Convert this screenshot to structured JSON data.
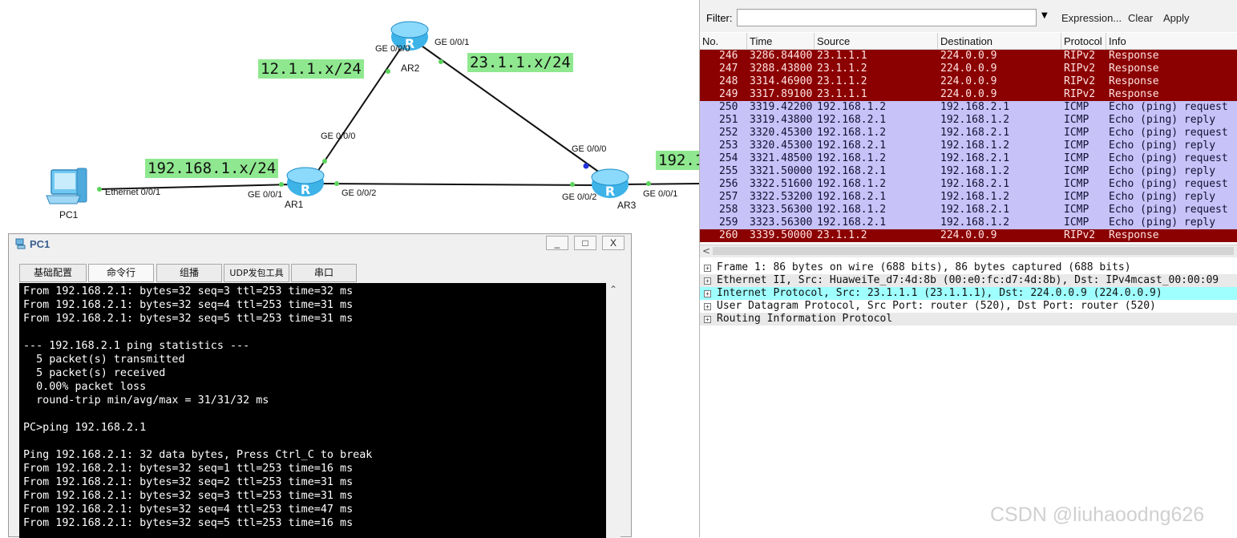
{
  "topology": {
    "networks": {
      "ar1_ar2": "12.1.1.x/24",
      "ar2_ar3": "23.1.1.x/24",
      "pc_lan": "192.168.1.x/24",
      "ar3_lan": "192.1"
    },
    "devices": {
      "pc1": "PC1",
      "ar1": "AR1",
      "ar2": "AR2",
      "ar3": "AR3"
    },
    "router_glyph": "R",
    "ports": {
      "pc1_eth": "Ethernet 0/0/1",
      "ar1_g001": "GE 0/0/1",
      "ar1_g000": "GE 0/0/0",
      "ar1_g002": "GE 0/0/2",
      "ar2_g000": "GE 0/0/0",
      "ar2_g001": "GE 0/0/1",
      "ar3_g000": "GE 0/0/0",
      "ar3_g002": "GE 0/0/2",
      "ar3_g001": "GE 0/0/1"
    }
  },
  "pc_window": {
    "title": "PC1",
    "buttons": {
      "minimize": "_",
      "maximize": "□",
      "close": "X"
    },
    "tabs": [
      "基础配置",
      "命令行",
      "组播",
      "UDP发包工具",
      "串口"
    ],
    "active_tab": "命令行",
    "console_lines": [
      "From 192.168.2.1: bytes=32 seq=3 ttl=253 time=32 ms",
      "From 192.168.2.1: bytes=32 seq=4 ttl=253 time=31 ms",
      "From 192.168.2.1: bytes=32 seq=5 ttl=253 time=31 ms",
      "",
      "--- 192.168.2.1 ping statistics ---",
      "  5 packet(s) transmitted",
      "  5 packet(s) received",
      "  0.00% packet loss",
      "  round-trip min/avg/max = 31/31/32 ms",
      "",
      "PC>ping 192.168.2.1",
      "",
      "Ping 192.168.2.1: 32 data bytes, Press Ctrl_C to break",
      "From 192.168.2.1: bytes=32 seq=1 ttl=253 time=16 ms",
      "From 192.168.2.1: bytes=32 seq=2 ttl=253 time=31 ms",
      "From 192.168.2.1: bytes=32 seq=3 ttl=253 time=31 ms",
      "From 192.168.2.1: bytes=32 seq=4 ttl=253 time=47 ms",
      "From 192.168.2.1: bytes=32 seq=5 ttl=253 time=16 ms"
    ],
    "scroll_up_glyph": "⌃"
  },
  "wireshark": {
    "filter": {
      "label": "Filter:",
      "value": "",
      "dropdown": "▼",
      "expression": "Expression...",
      "clear": "Clear",
      "apply": "Apply"
    },
    "columns": [
      "No.",
      "Time",
      "Source",
      "Destination",
      "Protocol",
      "Info"
    ],
    "packets": [
      {
        "no": "246",
        "time": "3286.84400",
        "src": "23.1.1.1",
        "dst": "224.0.0.9",
        "proto": "RIPv2",
        "info": "Response"
      },
      {
        "no": "247",
        "time": "3288.43800",
        "src": "23.1.1.2",
        "dst": "224.0.0.9",
        "proto": "RIPv2",
        "info": "Response"
      },
      {
        "no": "248",
        "time": "3314.46900",
        "src": "23.1.1.2",
        "dst": "224.0.0.9",
        "proto": "RIPv2",
        "info": "Response"
      },
      {
        "no": "249",
        "time": "3317.89100",
        "src": "23.1.1.1",
        "dst": "224.0.0.9",
        "proto": "RIPv2",
        "info": "Response"
      },
      {
        "no": "250",
        "time": "3319.42200",
        "src": "192.168.1.2",
        "dst": "192.168.2.1",
        "proto": "ICMP",
        "info": "Echo (ping) request"
      },
      {
        "no": "251",
        "time": "3319.43800",
        "src": "192.168.2.1",
        "dst": "192.168.1.2",
        "proto": "ICMP",
        "info": "Echo (ping) reply"
      },
      {
        "no": "252",
        "time": "3320.45300",
        "src": "192.168.1.2",
        "dst": "192.168.2.1",
        "proto": "ICMP",
        "info": "Echo (ping) request"
      },
      {
        "no": "253",
        "time": "3320.45300",
        "src": "192.168.2.1",
        "dst": "192.168.1.2",
        "proto": "ICMP",
        "info": "Echo (ping) reply"
      },
      {
        "no": "254",
        "time": "3321.48500",
        "src": "192.168.1.2",
        "dst": "192.168.2.1",
        "proto": "ICMP",
        "info": "Echo (ping) request"
      },
      {
        "no": "255",
        "time": "3321.50000",
        "src": "192.168.2.1",
        "dst": "192.168.1.2",
        "proto": "ICMP",
        "info": "Echo (ping) reply"
      },
      {
        "no": "256",
        "time": "3322.51600",
        "src": "192.168.1.2",
        "dst": "192.168.2.1",
        "proto": "ICMP",
        "info": "Echo (ping) request"
      },
      {
        "no": "257",
        "time": "3322.53200",
        "src": "192.168.2.1",
        "dst": "192.168.1.2",
        "proto": "ICMP",
        "info": "Echo (ping) reply"
      },
      {
        "no": "258",
        "time": "3323.56300",
        "src": "192.168.1.2",
        "dst": "192.168.2.1",
        "proto": "ICMP",
        "info": "Echo (ping) request"
      },
      {
        "no": "259",
        "time": "3323.56300",
        "src": "192.168.2.1",
        "dst": "192.168.1.2",
        "proto": "ICMP",
        "info": "Echo (ping) reply"
      },
      {
        "no": "260",
        "time": "3339.50000",
        "src": "23.1.1.2",
        "dst": "224.0.0.9",
        "proto": "RIPv2",
        "info": "Response"
      }
    ],
    "details": [
      {
        "text": "Frame 1: 86 bytes on wire (688 bits), 86 bytes captured (688 bits)",
        "style": "plain"
      },
      {
        "text": "Ethernet II, Src: HuaweiTe_d7:4d:8b (00:e0:fc:d7:4d:8b), Dst: IPv4mcast_00:00:09",
        "style": "grey"
      },
      {
        "text": "Internet Protocol, Src: 23.1.1.1 (23.1.1.1), Dst: 224.0.0.9 (224.0.0.9)",
        "style": "selected"
      },
      {
        "text": "User Datagram Protocol, Src Port: router (520), Dst Port: router (520)",
        "style": "plain"
      },
      {
        "text": "Routing Information Protocol",
        "style": "grey"
      }
    ],
    "expander_glyph": "+",
    "scroll_left_glyph": "<",
    "colors": {
      "rip_row": "#8b0000",
      "icmp_row": "#c7c2f7",
      "selected_detail": "#9fffff"
    }
  },
  "watermark": "CSDN @liuhaoodng626"
}
